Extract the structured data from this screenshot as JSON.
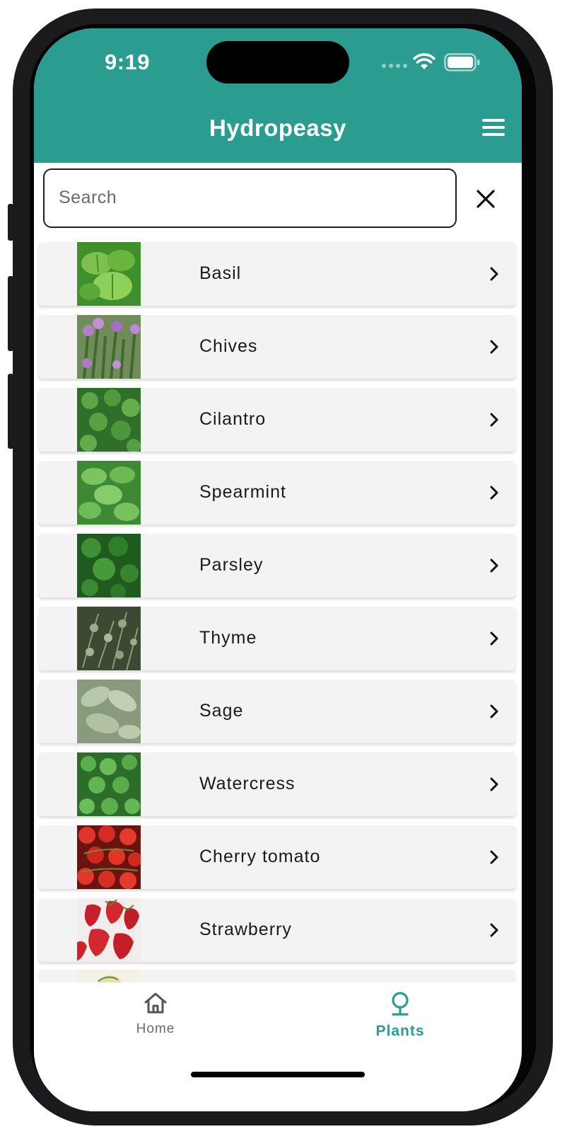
{
  "status_bar": {
    "time": "9:19"
  },
  "app_bar": {
    "title": "Hydropeasy",
    "menu_icon": "hamburger-menu-icon"
  },
  "search": {
    "placeholder": "Search",
    "value": "",
    "clear_icon": "close-icon"
  },
  "plants": [
    {
      "name": "Basil",
      "thumb_color": "#5aa63c"
    },
    {
      "name": "Chives",
      "thumb_color": "#7a9a5a"
    },
    {
      "name": "Cilantro",
      "thumb_color": "#3f8a3a"
    },
    {
      "name": "Spearmint",
      "thumb_color": "#5fae4e"
    },
    {
      "name": "Parsley",
      "thumb_color": "#2f7a2d"
    },
    {
      "name": "Thyme",
      "thumb_color": "#6b7a5e"
    },
    {
      "name": "Sage",
      "thumb_color": "#a9b79a"
    },
    {
      "name": "Watercress",
      "thumb_color": "#4d9a46"
    },
    {
      "name": "Cherry tomato",
      "thumb_color": "#c8281e"
    },
    {
      "name": "Strawberry",
      "thumb_color": "#c01f2a"
    }
  ],
  "tabs": [
    {
      "label": "Home",
      "icon": "home-icon",
      "active": false
    },
    {
      "label": "Plants",
      "icon": "plant-icon",
      "active": true
    }
  ],
  "colors": {
    "accent": "#2a9d90",
    "row_background": "#f3f3f3"
  }
}
